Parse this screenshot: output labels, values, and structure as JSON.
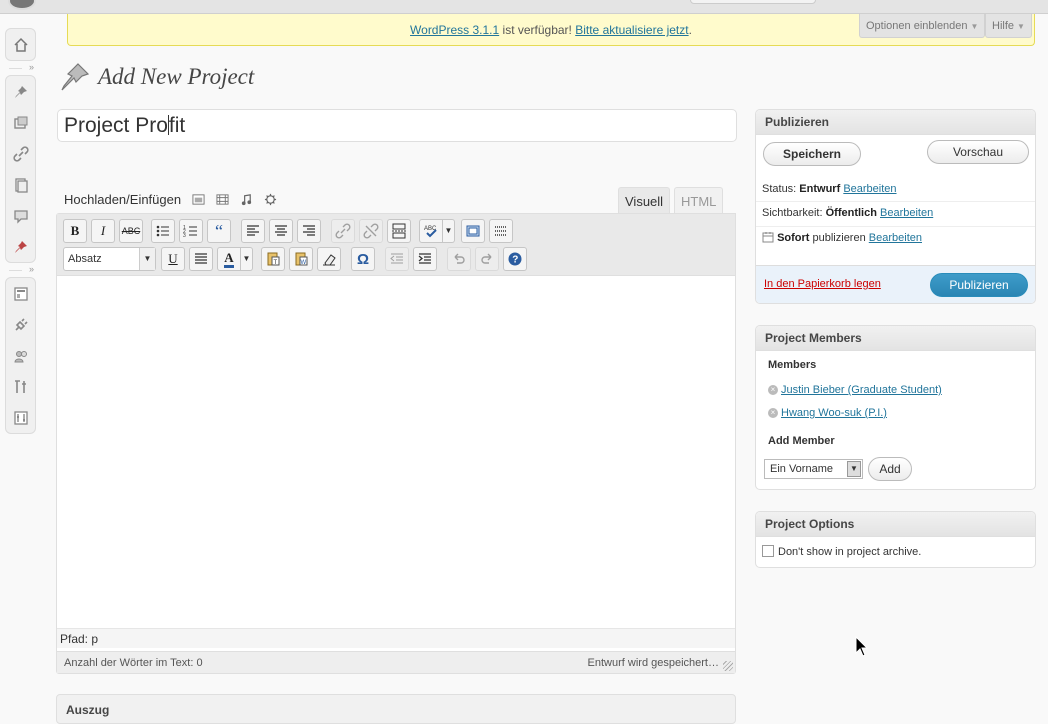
{
  "nag": {
    "version_link": "WordPress 3.1.1",
    "middle": " ist verfügbar! ",
    "update_link": "Bitte aktualisiere jetzt",
    "end": "."
  },
  "screen_options": {
    "options_label": "Optionen einblenden",
    "help_label": "Hilfe"
  },
  "page": {
    "title": "Add New Project"
  },
  "post_title": {
    "before_caret": "Project Pro",
    "after_caret": "fit"
  },
  "editor": {
    "media_label": "Hochladen/Einfügen",
    "tab_visual": "Visuell",
    "tab_html": "HTML",
    "format_select": "Absatz",
    "path_label": "Pfad: p",
    "word_count": "Anzahl der Wörter im Text: 0",
    "autosave": "Entwurf wird gespeichert…",
    "excerpt_peek": "Auszug"
  },
  "publish": {
    "title": "Publizieren",
    "save_label": "Speichern",
    "preview_label": "Vorschau",
    "status_label": "Status: ",
    "status_value": "Entwurf",
    "visibility_label": "Sichtbarkeit: ",
    "visibility_value": "Öffentlich",
    "schedule_value": "Sofort",
    "schedule_suffix": " publizieren ",
    "edit_link": "Bearbeiten",
    "trash_label": "In den Papierkorb legen",
    "publish_label": "Publizieren"
  },
  "members": {
    "title": "Project Members",
    "members_label": "Members",
    "list": [
      "Justin Bieber (Graduate Student)",
      "Hwang Woo-suk (P.I.)"
    ],
    "add_label": "Add Member",
    "select_value": "Ein Vorname",
    "add_button": "Add"
  },
  "options": {
    "title": "Project Options",
    "archive_checkbox": "Don't show in project archive."
  },
  "colors": {
    "link": "#21759b",
    "nag_bg": "#fffbcc",
    "primary": "#2a85b4",
    "trash": "#cc0000"
  }
}
